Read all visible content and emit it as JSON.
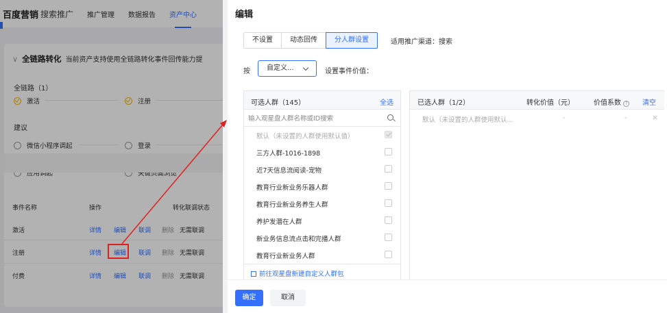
{
  "background": {
    "brand": "百度营销",
    "brand_sub": "搜索推广",
    "nav": [
      "推广管理",
      "数据报告",
      "资产中心"
    ],
    "fullchain": {
      "title": "全链路转化",
      "desc": "当前资产支持使用全链路转化事件回传能力提"
    },
    "chain_label": "全链路（1）",
    "chain_steps": [
      "激活",
      "注册"
    ],
    "suggest_label": "建议",
    "suggest_steps": [
      "微信小程序调起",
      "登录",
      "应用调起",
      "关键页面浏览"
    ],
    "table": {
      "headers": [
        "事件名称",
        "操作",
        "转化联调状态"
      ],
      "rows": [
        {
          "name": "激活",
          "ops": [
            "详情",
            "编辑",
            "联调",
            "删除"
          ],
          "status": "无需联调"
        },
        {
          "name": "注册",
          "ops": [
            "详情",
            "编辑",
            "联调",
            "删除"
          ],
          "status": "无需联调"
        },
        {
          "name": "付费",
          "ops": [
            "详情",
            "编辑",
            "联调",
            "删除"
          ],
          "status": "无需联调"
        }
      ]
    }
  },
  "drawer": {
    "title": "编辑",
    "segments": [
      "不设置",
      "动态回传",
      "分人群设置"
    ],
    "active_segment": 2,
    "channel": "适用推广渠道：搜索",
    "by_label": "按",
    "select_value": "自定义...",
    "set_label": "设置事件价值：",
    "left_panel": {
      "title": "可选人群（145）",
      "select_all": "全选",
      "search_placeholder": "输入观星盘人群名称或ID搜索",
      "items": [
        {
          "name": "默认（未设置的人群使用默认值）",
          "disabled": true
        },
        {
          "name": "三方人群-1016-1898",
          "disabled": false
        },
        {
          "name": "近7天信息流阅读-宠物",
          "disabled": false
        },
        {
          "name": "教育行业新业务乐器人群",
          "disabled": false
        },
        {
          "name": "教育行业新业务养生人群",
          "disabled": false
        },
        {
          "name": "养护发潜在人群",
          "disabled": false
        },
        {
          "name": "新业务信息流点击和完播人群",
          "disabled": false
        },
        {
          "name": "教育行业新业务人群",
          "disabled": false
        }
      ],
      "new_link": "前往观星盘新建自定义人群包"
    },
    "right_panel": {
      "title": "已选人群（1/2）",
      "col_value": "转化价值（元）",
      "col_coef": "价值系数",
      "clear": "清空",
      "selected": [
        {
          "name": "默认（未设置的人群使用默认...",
          "value": "-",
          "coef": "-"
        }
      ]
    },
    "ok": "确定",
    "cancel": "取消"
  }
}
